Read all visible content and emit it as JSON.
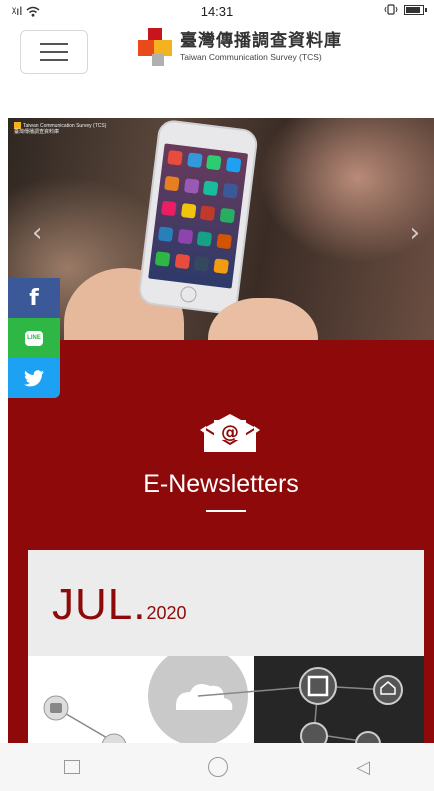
{
  "status_bar": {
    "signal_text": "ᵡıl",
    "time": "14:31"
  },
  "header": {
    "brand_cn": "臺灣傳播調查資料庫",
    "brand_en": "Taiwan Communication Survey (TCS)",
    "menu_icon": "hamburger-icon"
  },
  "hero": {
    "caption_line1": "Taiwan Communication Survey (TCS)",
    "caption_line2": "臺灣傳播調查資料庫",
    "prev_arrow": "‹",
    "next_arrow": "›"
  },
  "share": {
    "facebook": "f",
    "line": "LINE",
    "twitter_icon": "twitter-icon"
  },
  "newsletter": {
    "title": "E-Newsletters",
    "card": {
      "month": "JUL.",
      "year": "2020"
    }
  },
  "colors": {
    "section_red": "#8e0a0a",
    "facebook": "#3b5998",
    "line": "#2fb746",
    "twitter": "#1da1f2"
  }
}
